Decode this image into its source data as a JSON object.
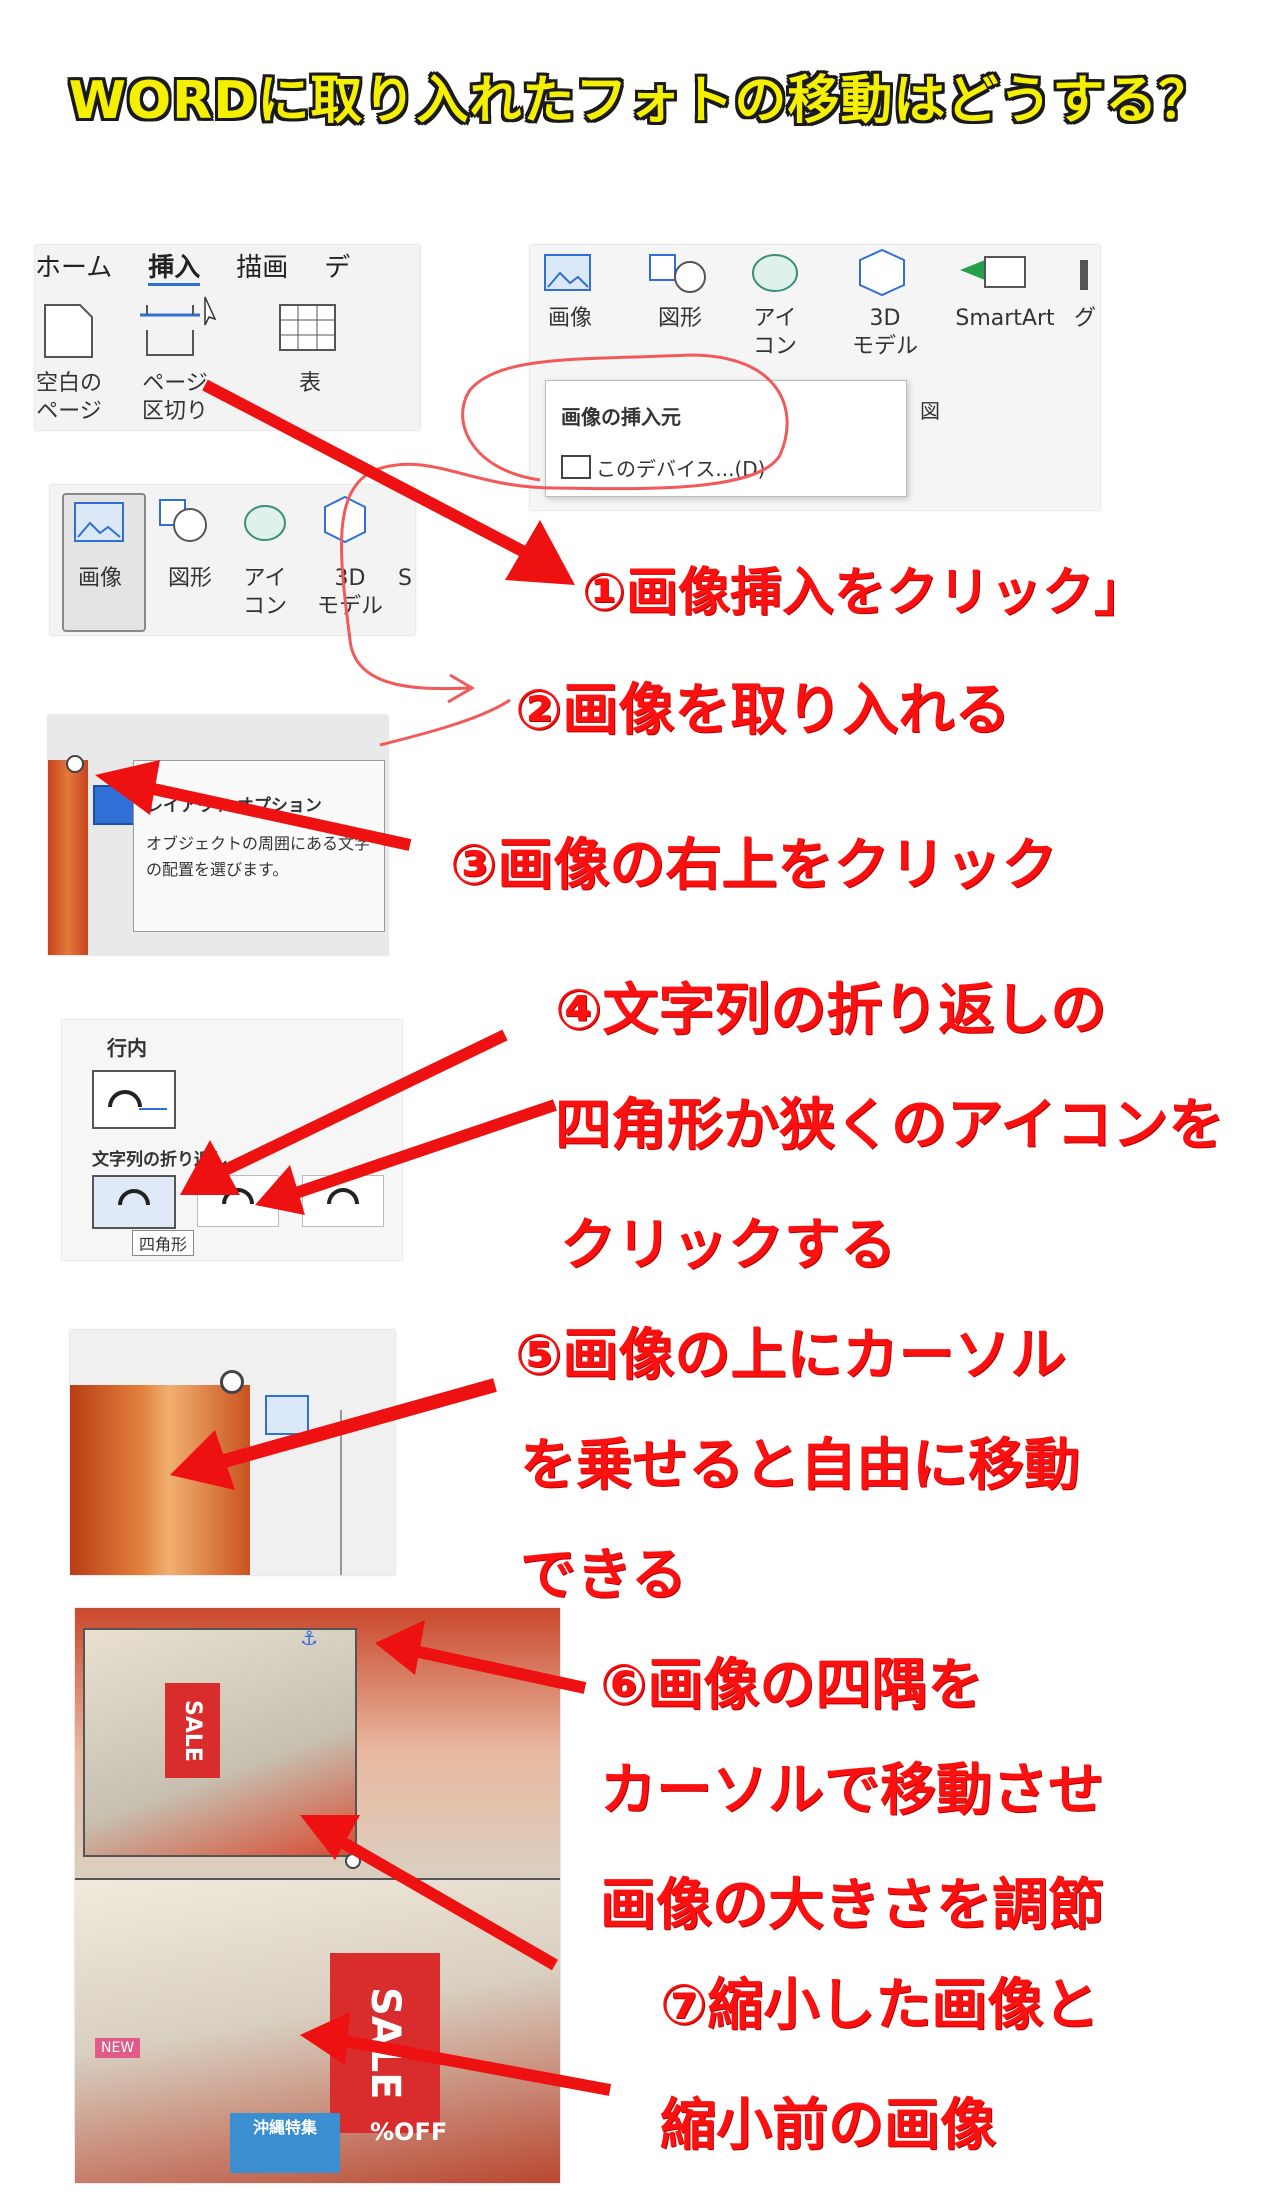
{
  "title": "WORDに取り入れたフォトの移動はどうする？",
  "panel1": {
    "tabs": [
      "ホーム",
      "挿入",
      "描画",
      "デ"
    ],
    "items": [
      {
        "label": "空白の\nページ"
      },
      {
        "label": "ページ\n区切り"
      },
      {
        "label": "表"
      }
    ]
  },
  "panel2": {
    "items": [
      "画像",
      "図形",
      "アイ\nコン",
      "3D\nモデル",
      "SmartArt",
      "グ"
    ],
    "menu_title": "画像の挿入元",
    "menu_item": "このデバイス...(D)",
    "menu_side": "図"
  },
  "panel3": {
    "items": [
      "画像",
      "図形",
      "アイ\nコン",
      "3D\nモデル",
      "S"
    ]
  },
  "panel4": {
    "tooltip_title": "レイアウト オプション",
    "tooltip_body": "オブジェクトの周囲にある文字の配置を選びます。"
  },
  "panel5": {
    "inline_label": "行内",
    "wrap_label": "文字列の折り返し",
    "tooltip": "四角形"
  },
  "panel7": {
    "sale_text": "SALE",
    "off_text": "%OFF",
    "okinawa_text": "沖縄特集",
    "new_text": "NEW"
  },
  "steps": {
    "s1": "①画像挿入をクリック」",
    "s2": "②画像を取り入れる",
    "s3": "③画像の右上をクリック",
    "s4a": "④文字列の折り返しの",
    "s4b": "四角形か狭くのアイコンを",
    "s4c": "クリックする",
    "s5a": "⑤画像の上にカーソル",
    "s5b": "を乗せると自由に移動",
    "s5c": "できる",
    "s6a": "⑥画像の四隅を",
    "s6b": "カーソルで移動させ",
    "s6c": "画像の大きさを調節",
    "s7a": "⑦縮小した画像と",
    "s7b": "縮小前の画像"
  },
  "colors": {
    "title": "#f5f000",
    "caption": "#ff1010",
    "arrow": "#ee1111",
    "accent_blue": "#2f6fd6"
  }
}
